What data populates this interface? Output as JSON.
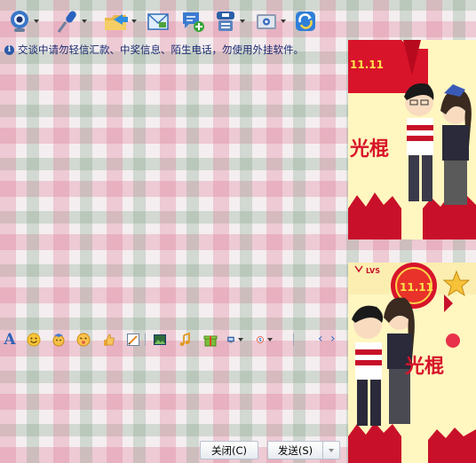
{
  "toolbar": {
    "items": [
      {
        "name": "video-call",
        "icon": "webcam-icon"
      },
      {
        "name": "voice-call",
        "icon": "microphone-icon"
      },
      {
        "name": "send-file",
        "icon": "folder-send-icon"
      },
      {
        "name": "send-mail",
        "icon": "mail-icon"
      },
      {
        "name": "create-discussion",
        "icon": "chat-add-icon"
      },
      {
        "name": "remote-assist",
        "icon": "user-card-icon"
      },
      {
        "name": "apps",
        "icon": "app-box-icon"
      },
      {
        "name": "sync",
        "icon": "refresh-icon"
      }
    ]
  },
  "notice": {
    "text": "交谈中请勿轻信汇款、中奖信息、陌生电话，勿使用外挂软件。"
  },
  "format_bar": {
    "font_label": "A",
    "items": [
      "font",
      "emoticon",
      "magic-emoticon",
      "wink",
      "thumbs-up",
      "scribble",
      "screen-capture",
      "music",
      "gift",
      "video-send",
      "sogou"
    ]
  },
  "buttons": {
    "close_label": "关闭(C)",
    "send_label": "发送(S)"
  },
  "side_top": {
    "banner_text": "11.11",
    "caption": "光棍"
  },
  "side_bottom": {
    "badge_text": "LVS",
    "banner_text": "11.11",
    "caption": "光棍"
  },
  "colors": {
    "accent_blue": "#2b63b8",
    "banner_red": "#d8142a",
    "side_bg": "#fff8c8"
  }
}
